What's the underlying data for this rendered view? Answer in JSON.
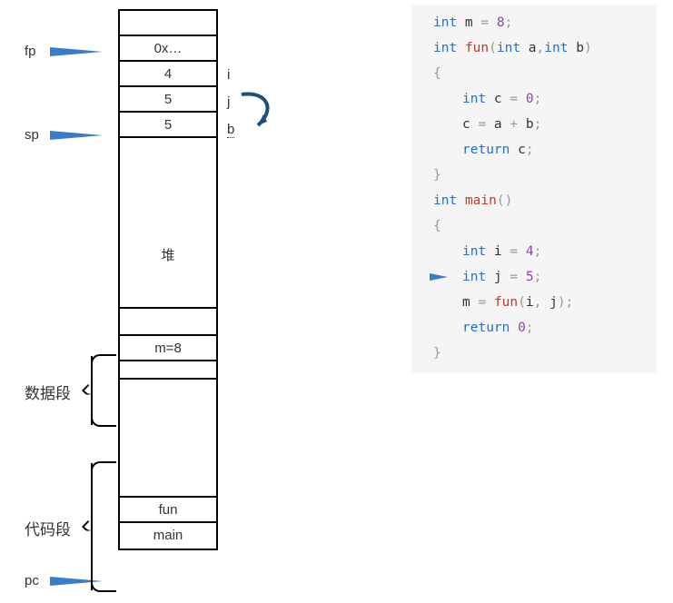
{
  "memory": {
    "cells": [
      {
        "value": ""
      },
      {
        "value": "0x…"
      },
      {
        "value": "4",
        "note": "i"
      },
      {
        "value": "5",
        "note": "j"
      },
      {
        "value": "5",
        "note": "b"
      }
    ],
    "heap_label": "堆",
    "data_cell": "m=8",
    "code_cells": [
      "fun",
      "main"
    ]
  },
  "pointers": {
    "fp": "fp",
    "sp": "sp",
    "pc": "pc"
  },
  "segments": {
    "data": "数据段",
    "code": "代码段"
  },
  "code": {
    "lines": [
      {
        "tokens": [
          "kw:int",
          " m ",
          "op:=",
          " ",
          "num:8",
          "pn:;"
        ]
      },
      {
        "tokens": [
          "kw:int",
          " ",
          "fn:fun",
          "pn:(",
          "kw:int",
          " a",
          "pn:,",
          "kw:int",
          " b",
          "pn:)"
        ]
      },
      {
        "tokens": [
          "pn:{"
        ]
      },
      {
        "indent": 1,
        "tokens": [
          "kw:int",
          " c ",
          "op:=",
          " ",
          "num:0",
          "pn:;"
        ]
      },
      {
        "indent": 1,
        "tokens": [
          "c ",
          "op:=",
          " a ",
          "op:+",
          " b",
          "pn:;"
        ]
      },
      {
        "indent": 1,
        "tokens": [
          "kw:return",
          " c",
          "pn:;"
        ]
      },
      {
        "tokens": [
          "pn:}"
        ]
      },
      {
        "tokens": [
          "kw:int",
          " ",
          "fn:main",
          "pn:()"
        ]
      },
      {
        "tokens": [
          "pn:{"
        ]
      },
      {
        "indent": 1,
        "tokens": [
          "kw:int",
          " i ",
          "op:=",
          " ",
          "num:4",
          "pn:;"
        ]
      },
      {
        "indent": 1,
        "arrow": true,
        "tokens": [
          "kw:int",
          " j ",
          "op:=",
          " ",
          "num:5",
          "pn:;"
        ]
      },
      {
        "indent": 1,
        "tokens": [
          "m ",
          "op:=",
          " ",
          "fn:fun",
          "pn:(",
          "i",
          "pn:,",
          " j",
          "pn:)",
          "pn:;"
        ]
      },
      {
        "indent": 1,
        "tokens": [
          "kw:return",
          " ",
          "num:0",
          "pn:;"
        ]
      },
      {
        "tokens": [
          "pn:}"
        ]
      }
    ]
  }
}
